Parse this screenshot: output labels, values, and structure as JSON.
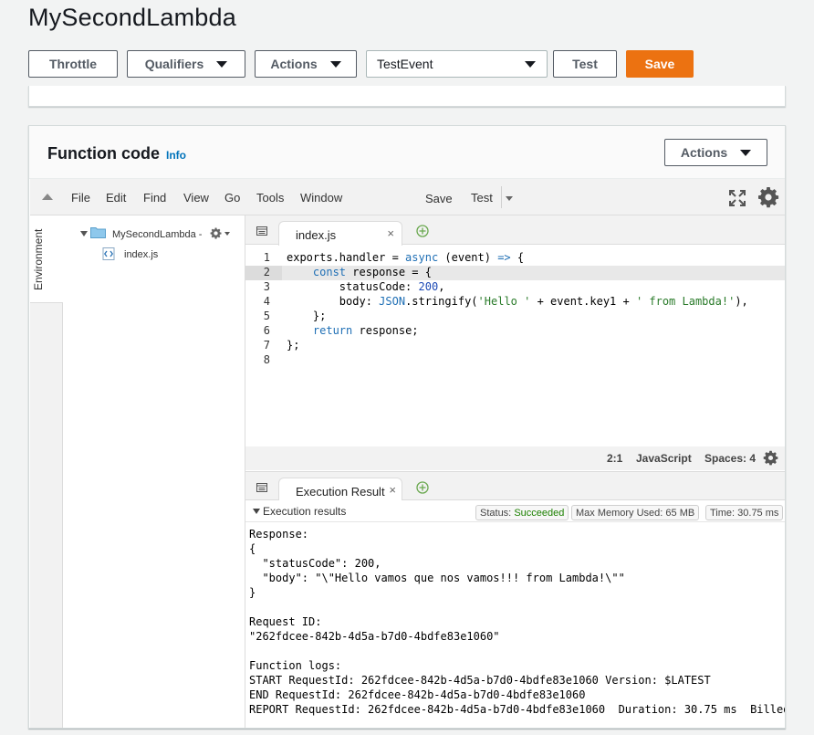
{
  "function_name": "MySecondLambda",
  "toolbar": {
    "throttle": "Throttle",
    "qualifiers": "Qualifiers",
    "actions": "Actions",
    "test_event": "TestEvent",
    "test": "Test",
    "save": "Save"
  },
  "function_code": {
    "title": "Function code",
    "info": "Info",
    "actions": "Actions"
  },
  "ide_menu": {
    "items": [
      "File",
      "Edit",
      "Find",
      "View",
      "Go",
      "Tools",
      "Window"
    ],
    "save": "Save",
    "test": "Test"
  },
  "environment_tab": "Environment",
  "file_tree": {
    "root": "MySecondLambda -",
    "files": [
      "index.js"
    ]
  },
  "editor": {
    "tab": "index.js",
    "line_numbers": [
      "1",
      "2",
      "3",
      "4",
      "5",
      "6",
      "7",
      "8"
    ],
    "code_lines": [
      "exports.handler = async (event) => {",
      "    const response = {",
      "        statusCode: 200,",
      "        body: JSON.stringify('Hello ' + event.key1 + ' from Lambda!'),",
      "    };",
      "    return response;",
      "};",
      ""
    ],
    "status": {
      "position": "2:1",
      "language": "JavaScript",
      "spaces": "Spaces: 4"
    }
  },
  "result": {
    "tab": "Execution Result",
    "section_title": "Execution results",
    "status_label": "Status:",
    "status_value": "Succeeded",
    "memory": "Max Memory Used: 65 MB",
    "time": "Time: 30.75 ms",
    "output_lines": [
      "Response:",
      "{",
      "  \"statusCode\": 200,",
      "  \"body\": \"\\\"Hello vamos que nos vamos!!! from Lambda!\\\"\"",
      "}",
      "",
      "Request ID:",
      "\"262fdcee-842b-4d5a-b7d0-4bdfe83e1060\"",
      "",
      "Function logs:",
      "START RequestId: 262fdcee-842b-4d5a-b7d0-4bdfe83e1060 Version: $LATEST",
      "END RequestId: 262fdcee-842b-4d5a-b7d0-4bdfe83e1060",
      "REPORT RequestId: 262fdcee-842b-4d5a-b7d0-4bdfe83e1060  Duration: 30.75 ms  Billed"
    ]
  },
  "colors": {
    "save_button": "#ec7211",
    "link": "#0073bb",
    "succeeded": "#1d8102"
  }
}
